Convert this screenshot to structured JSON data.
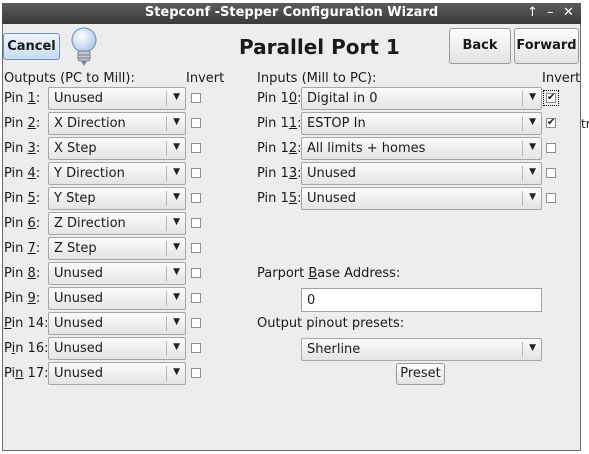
{
  "window": {
    "title": "Stepconf -Stepper Configuration Wizard",
    "controls": [
      "↑",
      "–",
      "✕"
    ]
  },
  "header": {
    "cancel": "Cancel",
    "page_title": "Parallel Port 1",
    "back": "Back",
    "forward": "Forward"
  },
  "outputs": {
    "heading": "Outputs (PC to Mill):",
    "invert_heading": "Invert",
    "pins": [
      {
        "pre": "Pin ",
        "u": "1",
        "post": ":",
        "value": "Unused",
        "inverted": false
      },
      {
        "pre": "Pin ",
        "u": "2",
        "post": ":",
        "value": "X Direction",
        "inverted": false
      },
      {
        "pre": "Pin ",
        "u": "3",
        "post": ":",
        "value": "X Step",
        "inverted": false
      },
      {
        "pre": "Pin ",
        "u": "4",
        "post": ":",
        "value": "Y Direction",
        "inverted": false
      },
      {
        "pre": "Pin ",
        "u": "5",
        "post": ":",
        "value": "Y Step",
        "inverted": false
      },
      {
        "pre": "Pin ",
        "u": "6",
        "post": ":",
        "value": "Z Direction",
        "inverted": false
      },
      {
        "pre": "Pin ",
        "u": "7",
        "post": ":",
        "value": "Z Step",
        "inverted": false
      },
      {
        "pre": "Pin ",
        "u": "8",
        "post": ":",
        "value": "Unused",
        "inverted": false
      },
      {
        "pre": "Pin ",
        "u": "9",
        "post": ":",
        "value": "Unused",
        "inverted": false
      },
      {
        "pre": "",
        "u": "P",
        "post": "in 14:",
        "value": "Unused",
        "inverted": false
      },
      {
        "pre": "P",
        "u": "i",
        "post": "n 16:",
        "value": "Unused",
        "inverted": false
      },
      {
        "pre": "Pi",
        "u": "n",
        "post": " 17:",
        "value": "Unused",
        "inverted": false
      }
    ]
  },
  "inputs": {
    "heading": "Inputs (Mill to PC):",
    "invert_heading": "Invert",
    "pins": [
      {
        "pre": "Pin 1",
        "u": "0",
        "post": ":",
        "value": "Digital in 0",
        "inverted": true
      },
      {
        "pre": "Pin 1",
        "u": "1",
        "post": ":",
        "value": "ESTOP In",
        "inverted": true
      },
      {
        "pre": "Pin 1",
        "u": "2",
        "post": ":",
        "value": "All limits + homes",
        "inverted": false
      },
      {
        "pre": "Pin 1",
        "u": "3",
        "post": ":",
        "value": "Unused",
        "inverted": false
      },
      {
        "pre": "Pin 1",
        "u": "5",
        "post": ":",
        "value": "Unused",
        "inverted": false
      }
    ]
  },
  "parport": {
    "pre": "Parport ",
    "u": "B",
    "post": "ase Address:",
    "value": "0"
  },
  "presets": {
    "label": "Output pinout presets:",
    "value": "Sherline",
    "button": "Preset"
  },
  "background_fragment": "tr"
}
